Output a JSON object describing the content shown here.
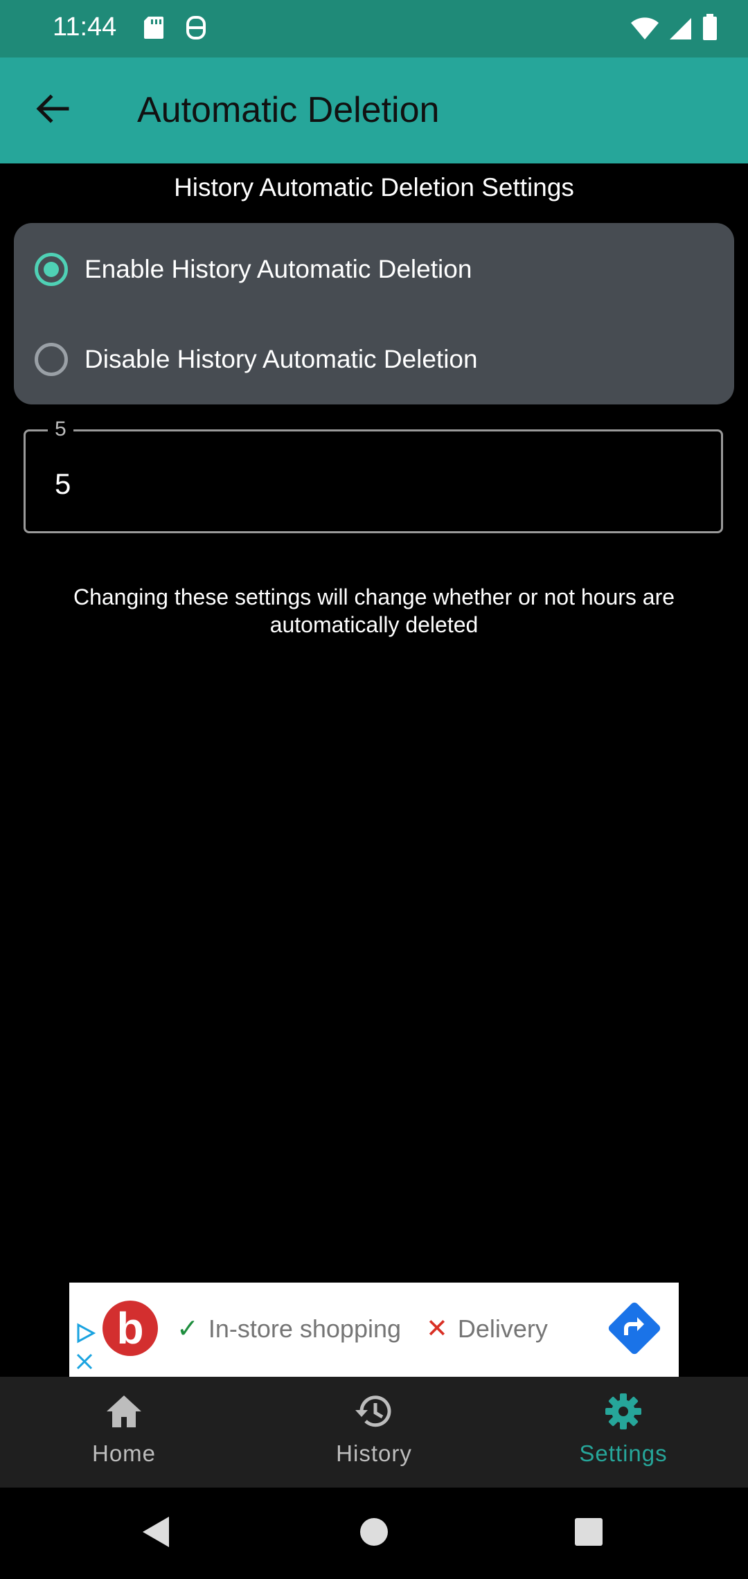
{
  "status_bar": {
    "time": "11:44",
    "icons_left": [
      "sd-card-icon",
      "sync-icon"
    ],
    "icons_right": [
      "wifi-icon",
      "signal-icon",
      "battery-icon"
    ]
  },
  "app_bar": {
    "title": "Automatic Deletion",
    "back_icon": "arrow-back-icon",
    "background": "#26a69a"
  },
  "section": {
    "title": "History Automatic Deletion Settings"
  },
  "radio_group": {
    "options": [
      {
        "label": "Enable History Automatic Deletion",
        "checked": true
      },
      {
        "label": "Disable History Automatic Deletion",
        "checked": false
      }
    ],
    "accent": "#4fd1b5"
  },
  "hours_field": {
    "label": "5",
    "value": "5"
  },
  "info": {
    "text": "Changing these settings will change whether or not hours are automatically deleted"
  },
  "ad": {
    "logo_letter": "b",
    "items": [
      {
        "mark": "✓",
        "text": "In-store shopping"
      },
      {
        "mark": "✕",
        "text": "Delivery"
      }
    ]
  },
  "bottom_nav": {
    "items": [
      {
        "label": "Home",
        "icon": "home-icon",
        "active": false
      },
      {
        "label": "History",
        "icon": "history-icon",
        "active": false
      },
      {
        "label": "Settings",
        "icon": "gear-icon",
        "active": true
      }
    ],
    "active_color": "#26a69a"
  },
  "system_nav": {
    "buttons": [
      "back-triangle-icon",
      "home-circle-icon",
      "recents-square-icon"
    ]
  }
}
